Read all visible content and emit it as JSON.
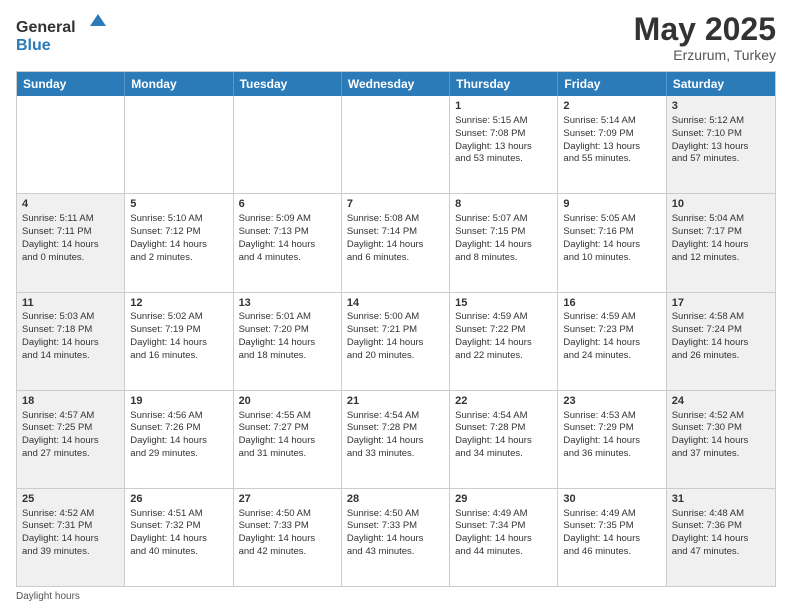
{
  "logo": {
    "general": "General",
    "blue": "Blue"
  },
  "title": "May 2025",
  "subtitle": "Erzurum, Turkey",
  "days": [
    "Sunday",
    "Monday",
    "Tuesday",
    "Wednesday",
    "Thursday",
    "Friday",
    "Saturday"
  ],
  "weeks": [
    [
      {
        "day": "",
        "info": ""
      },
      {
        "day": "",
        "info": ""
      },
      {
        "day": "",
        "info": ""
      },
      {
        "day": "",
        "info": ""
      },
      {
        "day": "1",
        "info": "Sunrise: 5:15 AM\nSunset: 7:08 PM\nDaylight: 13 hours\nand 53 minutes."
      },
      {
        "day": "2",
        "info": "Sunrise: 5:14 AM\nSunset: 7:09 PM\nDaylight: 13 hours\nand 55 minutes."
      },
      {
        "day": "3",
        "info": "Sunrise: 5:12 AM\nSunset: 7:10 PM\nDaylight: 13 hours\nand 57 minutes."
      }
    ],
    [
      {
        "day": "4",
        "info": "Sunrise: 5:11 AM\nSunset: 7:11 PM\nDaylight: 14 hours\nand 0 minutes."
      },
      {
        "day": "5",
        "info": "Sunrise: 5:10 AM\nSunset: 7:12 PM\nDaylight: 14 hours\nand 2 minutes."
      },
      {
        "day": "6",
        "info": "Sunrise: 5:09 AM\nSunset: 7:13 PM\nDaylight: 14 hours\nand 4 minutes."
      },
      {
        "day": "7",
        "info": "Sunrise: 5:08 AM\nSunset: 7:14 PM\nDaylight: 14 hours\nand 6 minutes."
      },
      {
        "day": "8",
        "info": "Sunrise: 5:07 AM\nSunset: 7:15 PM\nDaylight: 14 hours\nand 8 minutes."
      },
      {
        "day": "9",
        "info": "Sunrise: 5:05 AM\nSunset: 7:16 PM\nDaylight: 14 hours\nand 10 minutes."
      },
      {
        "day": "10",
        "info": "Sunrise: 5:04 AM\nSunset: 7:17 PM\nDaylight: 14 hours\nand 12 minutes."
      }
    ],
    [
      {
        "day": "11",
        "info": "Sunrise: 5:03 AM\nSunset: 7:18 PM\nDaylight: 14 hours\nand 14 minutes."
      },
      {
        "day": "12",
        "info": "Sunrise: 5:02 AM\nSunset: 7:19 PM\nDaylight: 14 hours\nand 16 minutes."
      },
      {
        "day": "13",
        "info": "Sunrise: 5:01 AM\nSunset: 7:20 PM\nDaylight: 14 hours\nand 18 minutes."
      },
      {
        "day": "14",
        "info": "Sunrise: 5:00 AM\nSunset: 7:21 PM\nDaylight: 14 hours\nand 20 minutes."
      },
      {
        "day": "15",
        "info": "Sunrise: 4:59 AM\nSunset: 7:22 PM\nDaylight: 14 hours\nand 22 minutes."
      },
      {
        "day": "16",
        "info": "Sunrise: 4:59 AM\nSunset: 7:23 PM\nDaylight: 14 hours\nand 24 minutes."
      },
      {
        "day": "17",
        "info": "Sunrise: 4:58 AM\nSunset: 7:24 PM\nDaylight: 14 hours\nand 26 minutes."
      }
    ],
    [
      {
        "day": "18",
        "info": "Sunrise: 4:57 AM\nSunset: 7:25 PM\nDaylight: 14 hours\nand 27 minutes."
      },
      {
        "day": "19",
        "info": "Sunrise: 4:56 AM\nSunset: 7:26 PM\nDaylight: 14 hours\nand 29 minutes."
      },
      {
        "day": "20",
        "info": "Sunrise: 4:55 AM\nSunset: 7:27 PM\nDaylight: 14 hours\nand 31 minutes."
      },
      {
        "day": "21",
        "info": "Sunrise: 4:54 AM\nSunset: 7:28 PM\nDaylight: 14 hours\nand 33 minutes."
      },
      {
        "day": "22",
        "info": "Sunrise: 4:54 AM\nSunset: 7:28 PM\nDaylight: 14 hours\nand 34 minutes."
      },
      {
        "day": "23",
        "info": "Sunrise: 4:53 AM\nSunset: 7:29 PM\nDaylight: 14 hours\nand 36 minutes."
      },
      {
        "day": "24",
        "info": "Sunrise: 4:52 AM\nSunset: 7:30 PM\nDaylight: 14 hours\nand 37 minutes."
      }
    ],
    [
      {
        "day": "25",
        "info": "Sunrise: 4:52 AM\nSunset: 7:31 PM\nDaylight: 14 hours\nand 39 minutes."
      },
      {
        "day": "26",
        "info": "Sunrise: 4:51 AM\nSunset: 7:32 PM\nDaylight: 14 hours\nand 40 minutes."
      },
      {
        "day": "27",
        "info": "Sunrise: 4:50 AM\nSunset: 7:33 PM\nDaylight: 14 hours\nand 42 minutes."
      },
      {
        "day": "28",
        "info": "Sunrise: 4:50 AM\nSunset: 7:33 PM\nDaylight: 14 hours\nand 43 minutes."
      },
      {
        "day": "29",
        "info": "Sunrise: 4:49 AM\nSunset: 7:34 PM\nDaylight: 14 hours\nand 44 minutes."
      },
      {
        "day": "30",
        "info": "Sunrise: 4:49 AM\nSunset: 7:35 PM\nDaylight: 14 hours\nand 46 minutes."
      },
      {
        "day": "31",
        "info": "Sunrise: 4:48 AM\nSunset: 7:36 PM\nDaylight: 14 hours\nand 47 minutes."
      }
    ]
  ],
  "footer": "Daylight hours"
}
